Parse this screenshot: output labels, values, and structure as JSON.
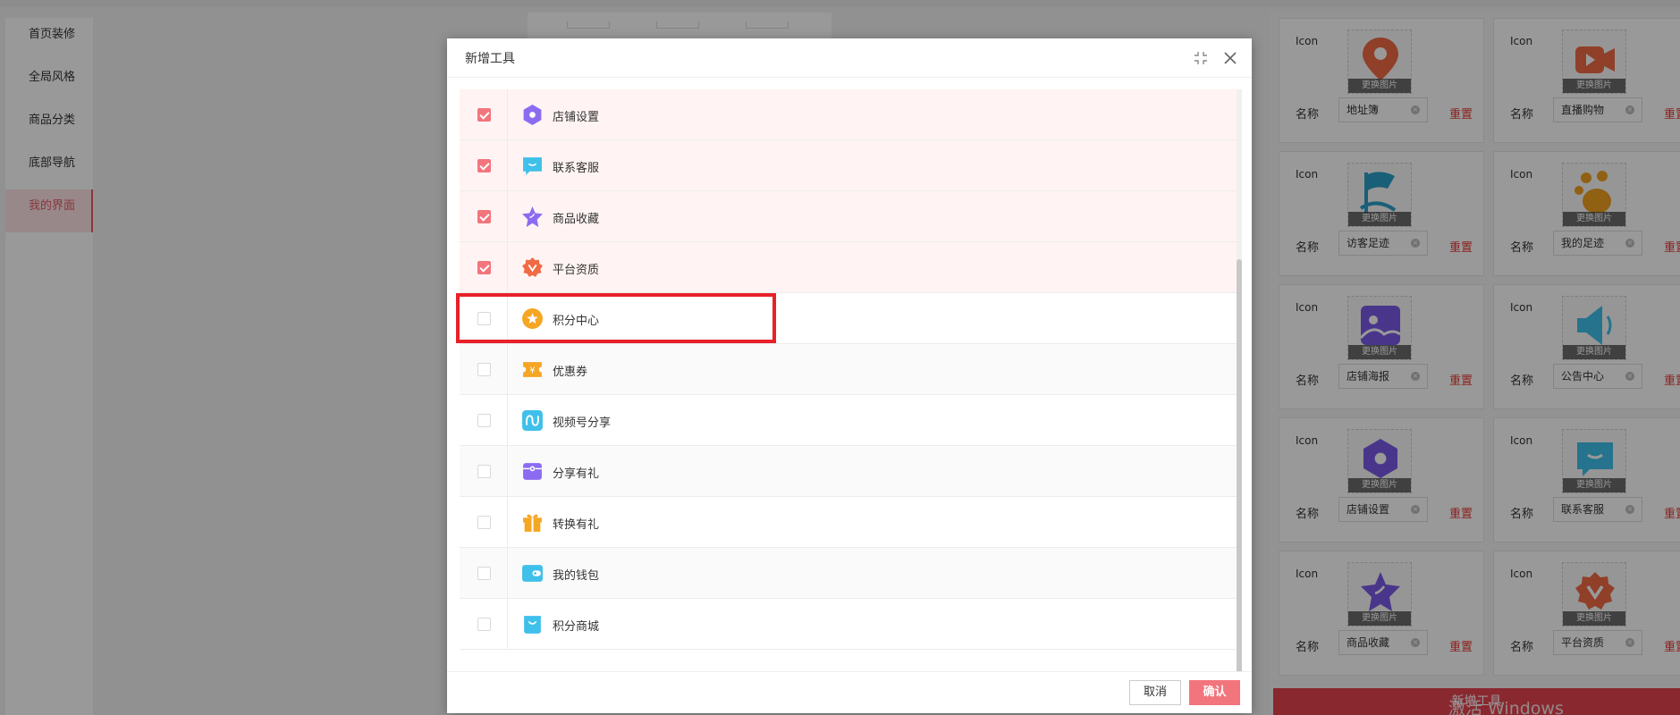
{
  "sidebar": {
    "items": [
      {
        "label": "首页装修",
        "active": false
      },
      {
        "label": "全局风格",
        "active": false
      },
      {
        "label": "商品分类",
        "active": false
      },
      {
        "label": "底部导航",
        "active": false
      },
      {
        "label": "我的界面",
        "active": true
      }
    ]
  },
  "right_panel": {
    "icon_label": "Icon",
    "name_label": "名称",
    "swap_label": "更换图片",
    "reset_label": "重置",
    "cards": [
      {
        "name": "地址簿",
        "icon": "location-pin-icon",
        "color": "#f06a45"
      },
      {
        "name": "直播购物",
        "icon": "video-camera-icon",
        "color": "#f06a45"
      },
      {
        "name": "访客足迹",
        "icon": "flag-icon",
        "color": "#2a9fc9"
      },
      {
        "name": "我的足迹",
        "icon": "paw-icon",
        "color": "#f0a020"
      },
      {
        "name": "店铺海报",
        "icon": "image-icon",
        "color": "#7b5be6"
      },
      {
        "name": "公告中心",
        "icon": "megaphone-icon",
        "color": "#3fc0ea"
      },
      {
        "name": "店铺设置",
        "icon": "hexagon-icon",
        "color": "#7b5be6"
      },
      {
        "name": "联系客服",
        "icon": "chat-bubble-icon",
        "color": "#3fc0ea"
      },
      {
        "name": "商品收藏",
        "icon": "star-icon",
        "color": "#7b5be6"
      },
      {
        "name": "平台资质",
        "icon": "badge-icon",
        "color": "#f06a45"
      }
    ],
    "add_button": "新增工具",
    "watermark": "激活 Windows"
  },
  "dialog": {
    "title": "新增工具",
    "cancel_label": "取消",
    "confirm_label": "确认",
    "rows": [
      {
        "label": "店铺设置",
        "checked": true,
        "icon": "hexagon-icon",
        "color": "#8b6cf0"
      },
      {
        "label": "联系客服",
        "checked": true,
        "icon": "chat-bubble-icon",
        "color": "#3fc0ea"
      },
      {
        "label": "商品收藏",
        "checked": true,
        "icon": "star-icon",
        "color": "#8b6cf0"
      },
      {
        "label": "平台资质",
        "checked": true,
        "icon": "badge-icon",
        "color": "#f06a45"
      },
      {
        "label": "积分中心",
        "checked": false,
        "icon": "points-star-icon",
        "color": "#f5a623"
      },
      {
        "label": "优惠券",
        "checked": false,
        "icon": "coupon-icon",
        "color": "#f5a623"
      },
      {
        "label": "视频号分享",
        "checked": false,
        "icon": "channel-share-icon",
        "color": "#3fc0ea"
      },
      {
        "label": "分享有礼",
        "checked": false,
        "icon": "share-gift-icon",
        "color": "#8b6cf0"
      },
      {
        "label": "转换有礼",
        "checked": false,
        "icon": "gift-box-icon",
        "color": "#f5a623"
      },
      {
        "label": "我的钱包",
        "checked": false,
        "icon": "wallet-icon",
        "color": "#3fc0ea"
      },
      {
        "label": "积分商城",
        "checked": false,
        "icon": "shopping-bag-icon",
        "color": "#3fc0ea"
      }
    ]
  }
}
